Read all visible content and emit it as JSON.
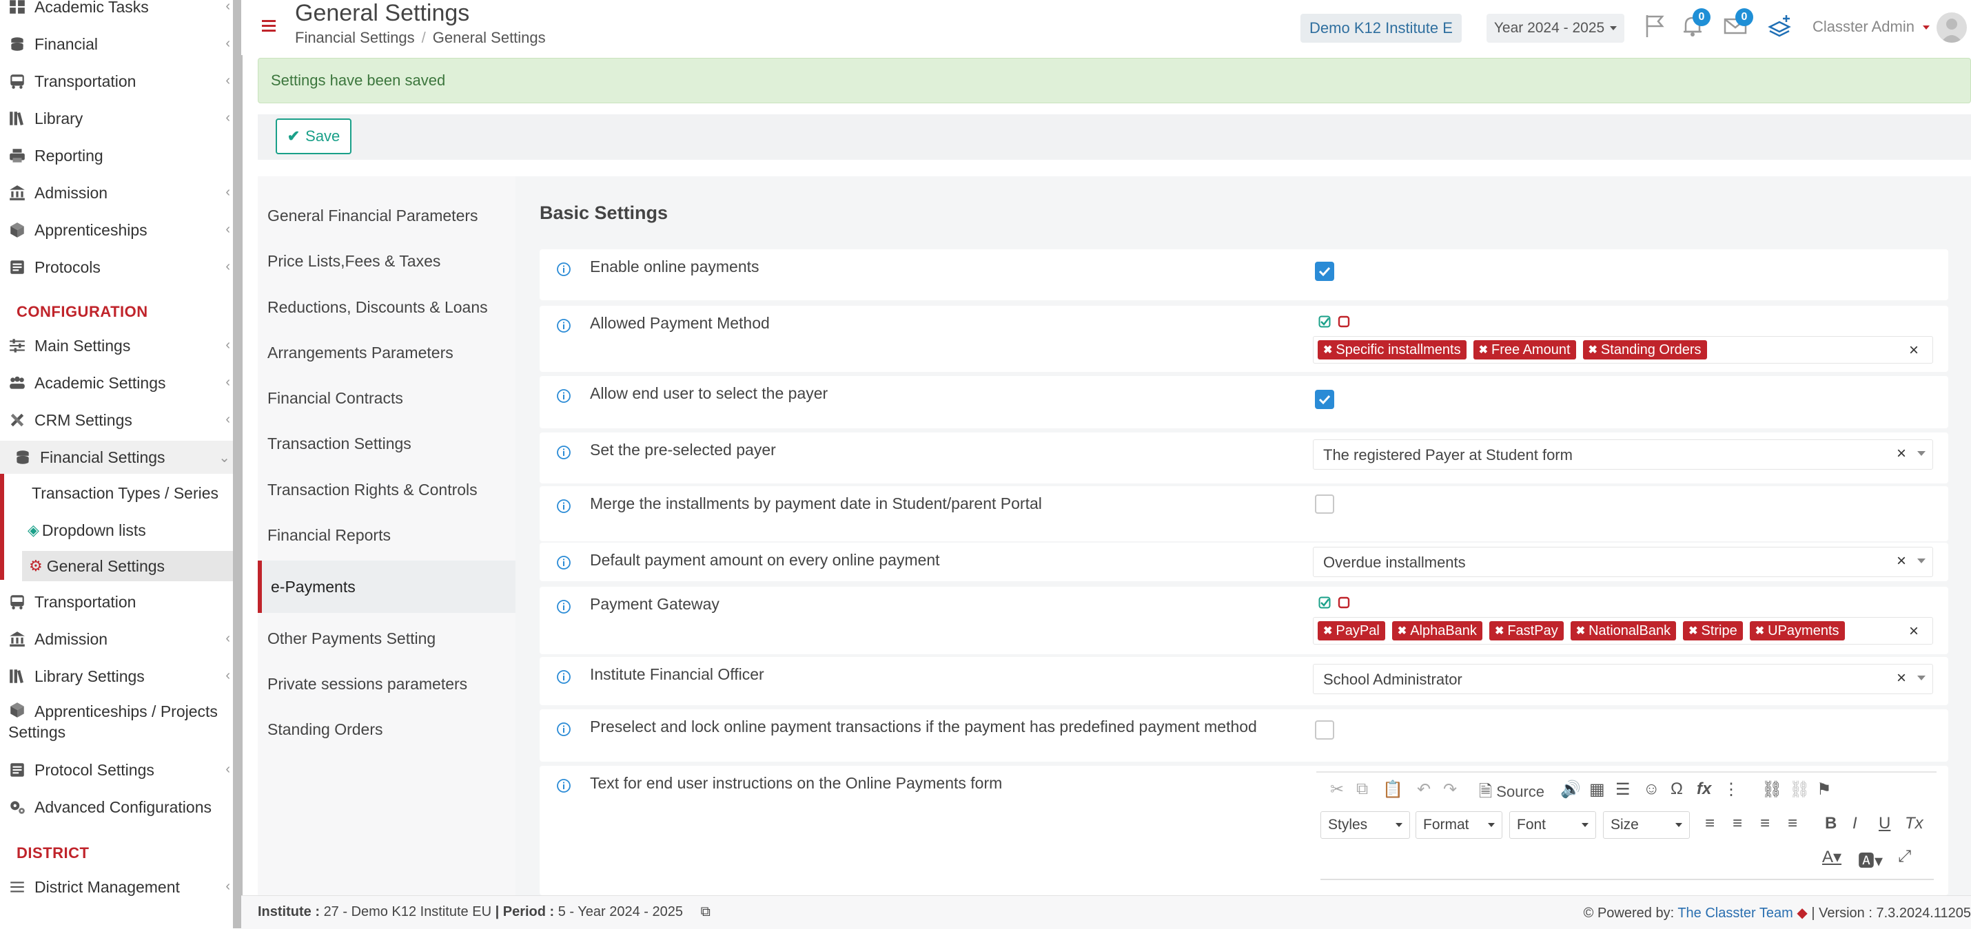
{
  "sidebar": {
    "items_top": [
      {
        "label": "Academic Tasks",
        "icon": "grid-icon"
      },
      {
        "label": "Financial",
        "icon": "coins-icon"
      },
      {
        "label": "Transportation",
        "icon": "bus-icon"
      },
      {
        "label": "Library",
        "icon": "books-icon"
      },
      {
        "label": "Reporting",
        "icon": "printer-icon"
      },
      {
        "label": "Admission",
        "icon": "institution-icon"
      },
      {
        "label": "Apprenticeships",
        "icon": "cube-icon"
      },
      {
        "label": "Protocols",
        "icon": "folder-icon"
      }
    ],
    "configuration_heading": "CONFIGURATION",
    "items_config": [
      {
        "label": "Main Settings",
        "icon": "sliders-icon"
      },
      {
        "label": "Academic Settings",
        "icon": "users-icon"
      },
      {
        "label": "CRM Settings",
        "icon": "tools-icon"
      },
      {
        "label": "Financial Settings",
        "icon": "coins-icon"
      }
    ],
    "financial_sub": {
      "item1": "Transaction Types / Series",
      "item2": "Dropdown lists",
      "item3": "General Settings"
    },
    "items_config2": [
      {
        "label": "Transportation",
        "icon": "bus-icon"
      },
      {
        "label": "Admission",
        "icon": "institution-icon"
      },
      {
        "label": "Library Settings",
        "icon": "books-icon"
      },
      {
        "label": "Apprenticeships / Projects",
        "label2": "Settings",
        "icon": "cube-icon"
      },
      {
        "label": "Protocol Settings",
        "icon": "folder-icon"
      },
      {
        "label": "Advanced Configurations",
        "icon": "gears-icon"
      }
    ],
    "district_heading": "DISTRICT",
    "district_item": {
      "label": "District Management",
      "icon": "list-icon"
    }
  },
  "header": {
    "title": "General Settings",
    "breadcrumb": {
      "first": "Financial Settings",
      "second": "General Settings"
    },
    "institute": "Demo K12 Institute E",
    "year": "Year 2024 - 2025",
    "notifications_count": "0",
    "messages_count": "0",
    "user_name": "Classter Admin"
  },
  "alert": {
    "text": "Settings have been saved"
  },
  "toolbar": {
    "save_label": "Save"
  },
  "settings_nav": {
    "items": [
      "General Financial Parameters",
      "Price Lists,Fees & Taxes",
      "Reductions, Discounts & Loans",
      "Arrangements Parameters",
      "Financial Contracts",
      "Transaction Settings",
      "Transaction Rights & Controls",
      "Financial Reports",
      "e-Payments",
      "Other Payments Setting",
      "Private sessions parameters",
      "Standing Orders"
    ],
    "active": "e-Payments"
  },
  "main": {
    "section_title": "Basic Settings",
    "rows": {
      "enable_online": {
        "label": "Enable online payments",
        "checked": true
      },
      "allowed_method": {
        "label": "Allowed Payment Method",
        "tags": [
          "Specific installments",
          "Free Amount",
          "Standing Orders"
        ]
      },
      "allow_select_payer": {
        "label": "Allow end user to select the payer",
        "checked": true
      },
      "preselected_payer": {
        "label": "Set the pre-selected payer",
        "value": "The registered Payer at Student form"
      },
      "merge_installments": {
        "label": "Merge the installments by payment date in Student/parent Portal",
        "checked": false
      },
      "default_amount": {
        "label": "Default payment amount on every online payment",
        "value": "Overdue installments"
      },
      "gateway": {
        "label": "Payment Gateway",
        "tags": [
          "PayPal",
          "AlphaBank",
          "FastPay",
          "NationalBank",
          "Stripe",
          "UPayments"
        ]
      },
      "officer": {
        "label": "Institute Financial Officer",
        "value": "School Administrator"
      },
      "preselect_lock": {
        "label": "Preselect and lock online payment transactions if the payment has predefined payment method",
        "checked": false
      },
      "instructions": {
        "label": "Text for end user instructions on the Online Payments form"
      }
    },
    "editor": {
      "source_label": "Source",
      "styles": "Styles",
      "format": "Format",
      "font": "Font",
      "size": "Size"
    }
  },
  "footer": {
    "institute_label": "Institute :",
    "institute_value": "27 - Demo K12 Institute EU",
    "period_label": "Period :",
    "period_value": "5 - Year 2024 - 2025",
    "powered_by": "Powered by:",
    "team": "The Classter Team",
    "version": "| Version : 7.3.2024.11205"
  },
  "colors": {
    "accent_red": "#c0242b",
    "success_green": "#1aa089",
    "checkbox_blue": "#2a8bd6",
    "badge_blue": "#1f8fd6"
  }
}
